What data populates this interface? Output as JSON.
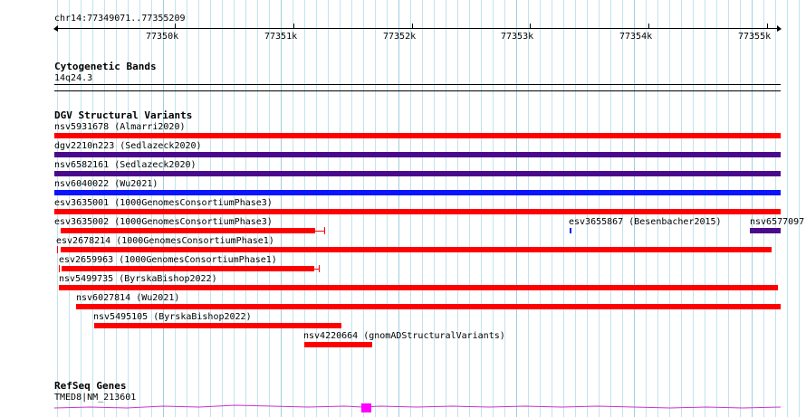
{
  "location": "chr14:77349071..77355209",
  "ruler": {
    "ticks": [
      {
        "label": "77350k",
        "pos": 77350000
      },
      {
        "label": "77351k",
        "pos": 77351000
      },
      {
        "label": "77352k",
        "pos": 77352000
      },
      {
        "label": "77353k",
        "pos": 77353000
      },
      {
        "label": "77354k",
        "pos": 77354000
      },
      {
        "label": "77355k",
        "pos": 77355000
      }
    ]
  },
  "tracks": {
    "cytoband": {
      "title": "Cytogenetic Bands",
      "band": "14q24.3"
    },
    "dgv": {
      "title": "DGV Structural Variants"
    },
    "refseq": {
      "title": "RefSeq Genes",
      "gene": "TMED8|NM_213601"
    }
  },
  "variants": [
    {
      "label": "nsv5931678 (Almarri2020)",
      "color": "#ff0000",
      "kind": "loss"
    },
    {
      "label": "dgv2210n223 (Sedlazeck2020)",
      "color": "#4b0a8c",
      "kind": "complex"
    },
    {
      "label": "nsv6582161 (Sedlazeck2020)",
      "color": "#4b0a8c",
      "kind": "complex"
    },
    {
      "label": "nsv6040022 (Wu2021)",
      "color": "#0a14ff",
      "kind": "gain"
    },
    {
      "label": "esv3635001 (1000GenomesConsortiumPhase3)",
      "color": "#ff0000",
      "kind": "loss"
    },
    {
      "label": "esv3635002 (1000GenomesConsortiumPhase3)",
      "color": "#ff0000",
      "kind": "loss"
    },
    {
      "label": "esv3655867 (Besenbacher2015)",
      "color": "#0a14ff",
      "kind": "gain"
    },
    {
      "label": "nsv6577097",
      "color": "#4b0a8c",
      "kind": "complex"
    },
    {
      "label": "esv2678214 (1000GenomesConsortiumPhase1)",
      "color": "#ff0000",
      "kind": "loss"
    },
    {
      "label": "esv2659963 (1000GenomesConsortiumPhase1)",
      "color": "#ff0000",
      "kind": "loss"
    },
    {
      "label": "nsv5499735 (ByrskaBishop2022)",
      "color": "#ff0000",
      "kind": "loss"
    },
    {
      "label": "nsv6027814 (Wu2021)",
      "color": "#ff0000",
      "kind": "loss"
    },
    {
      "label": "nsv5495105 (ByrskaBishop2022)",
      "color": "#ff0000",
      "kind": "loss"
    },
    {
      "label": "nsv4220664 (gnomADStructuralVariants)",
      "color": "#ff0000",
      "kind": "loss"
    }
  ],
  "colors": {
    "grid": "#c3e3ee",
    "gene": "#cc33cc",
    "exon": "#ff00ff"
  }
}
